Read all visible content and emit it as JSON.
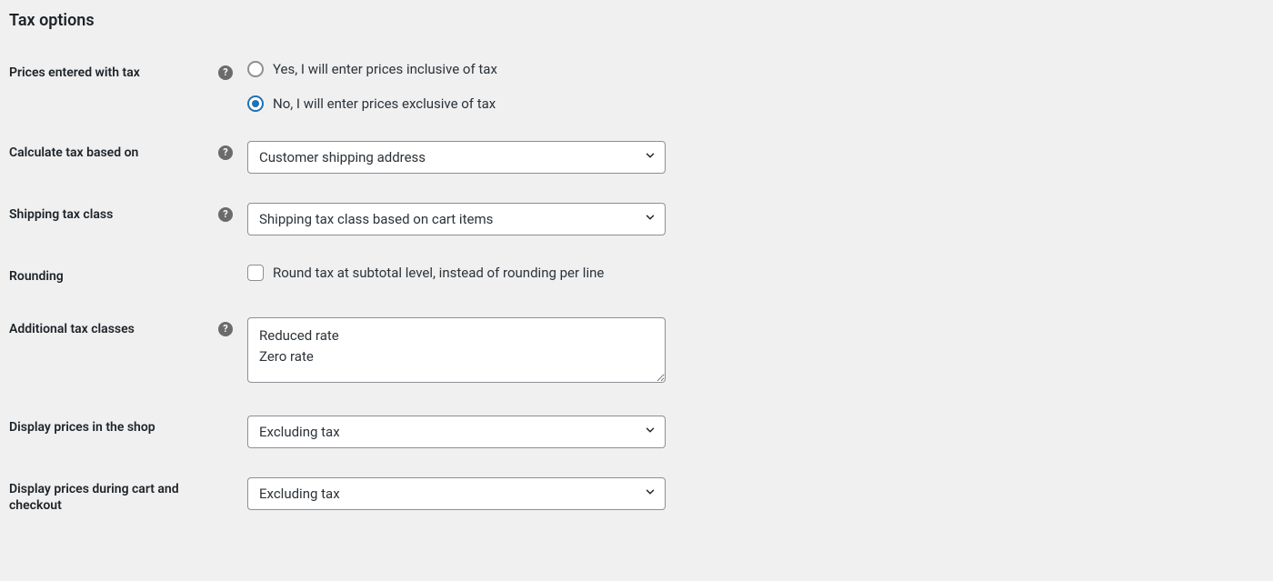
{
  "section": {
    "title": "Tax options"
  },
  "fields": {
    "prices_entered": {
      "label": "Prices entered with tax",
      "has_help": true,
      "options": [
        {
          "label": "Yes, I will enter prices inclusive of tax",
          "selected": false
        },
        {
          "label": "No, I will enter prices exclusive of tax",
          "selected": true
        }
      ]
    },
    "calculate_tax": {
      "label": "Calculate tax based on",
      "has_help": true,
      "value": "Customer shipping address"
    },
    "shipping_tax_class": {
      "label": "Shipping tax class",
      "has_help": true,
      "value": "Shipping tax class based on cart items"
    },
    "rounding": {
      "label": "Rounding",
      "has_help": false,
      "checkbox_label": "Round tax at subtotal level, instead of rounding per line",
      "checked": false
    },
    "additional_tax_classes": {
      "label": "Additional tax classes",
      "has_help": true,
      "value": "Reduced rate\nZero rate"
    },
    "display_shop": {
      "label": "Display prices in the shop",
      "has_help": false,
      "value": "Excluding tax"
    },
    "display_cart": {
      "label": "Display prices during cart and checkout",
      "has_help": false,
      "value": "Excluding tax"
    }
  }
}
